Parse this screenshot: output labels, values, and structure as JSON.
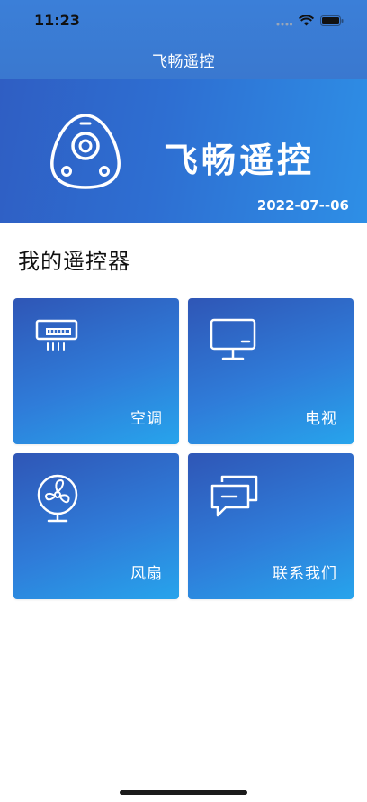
{
  "status": {
    "time": "11:23"
  },
  "nav": {
    "title": "飞畅遥控"
  },
  "banner": {
    "title": "飞畅遥控",
    "date": "2022-07--06",
    "icon": "remote-logo-icon"
  },
  "section": {
    "title": "我的遥控器"
  },
  "cards": [
    {
      "label": "空调",
      "icon": "air-conditioner-icon"
    },
    {
      "label": "电视",
      "icon": "tv-icon"
    },
    {
      "label": "风扇",
      "icon": "fan-icon"
    },
    {
      "label": "联系我们",
      "icon": "chat-icon"
    }
  ],
  "colors": {
    "accent": "#2f6fd2",
    "card_start": "#2f56b6",
    "card_end": "#27a4ec"
  }
}
